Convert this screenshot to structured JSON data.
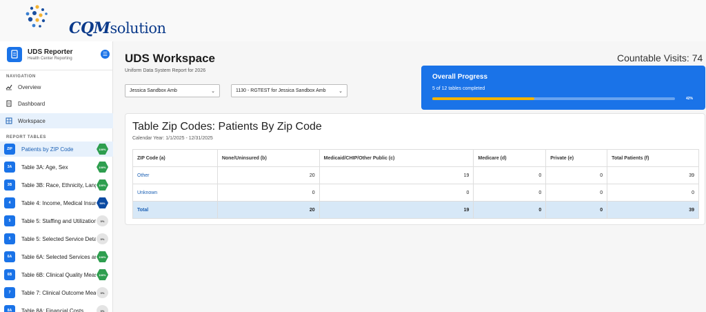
{
  "logo": {
    "text_prefix": "CQM",
    "text_suffix": "solution"
  },
  "sidebar": {
    "brand_title": "UDS Reporter",
    "brand_subtitle": "Health Center Reporting",
    "navigation_label": "NAVIGATION",
    "nav": [
      {
        "label": "Overview",
        "icon": "chart-line-icon"
      },
      {
        "label": "Dashboard",
        "icon": "document-icon"
      },
      {
        "label": "Workspace",
        "icon": "table-grid-icon"
      }
    ],
    "report_tables_label": "REPORT TABLES",
    "tables": [
      {
        "code": "ZIP",
        "label": "Patients by ZIP Code",
        "badge": "100%",
        "status": "complete"
      },
      {
        "code": "3A",
        "label": "Table 3A: Age, Sex",
        "badge": "100%",
        "status": "complete"
      },
      {
        "code": "3B",
        "label": "Table 3B: Race, Ethnicity, Lang",
        "badge": "100%",
        "status": "complete"
      },
      {
        "code": "4",
        "label": "Table 4: Income, Medical Insura",
        "badge": "90%",
        "status": "partial"
      },
      {
        "code": "5",
        "label": "Table 5: Staffing and Utilization",
        "badge": "0%",
        "status": "none"
      },
      {
        "code": "5",
        "label": "Table 5: Selected Service Detai",
        "badge": "0%",
        "status": "none"
      },
      {
        "code": "6A",
        "label": "Table 6A: Selected Services an",
        "badge": "100%",
        "status": "complete"
      },
      {
        "code": "6B",
        "label": "Table 6B: Clinical Quality Meas",
        "badge": "100%",
        "status": "complete"
      },
      {
        "code": "7",
        "label": "Table 7: Clinical Outcome Meas",
        "badge": "0%",
        "status": "none"
      },
      {
        "code": "8A",
        "label": "Table 8A: Financial Costs",
        "badge": "0%",
        "status": "none"
      }
    ]
  },
  "main": {
    "title": "UDS Workspace",
    "subtitle": "Uniform Data System Report for 2026",
    "countable_visits": "Countable Visits: 74",
    "select_org": "Jessica Sandbox Amb",
    "select_site": "1130 - RGTEST for Jessica Sandbox Amb"
  },
  "progress": {
    "title": "Overall Progress",
    "subtitle": "5 of 12 tables completed",
    "percent_label": "42%",
    "fraction": 0.42
  },
  "table_card": {
    "title": "Table Zip Codes: Patients By Zip Code",
    "subtitle": "Calendar Year: 1/1/2025 - 12/31/2025",
    "columns": [
      "ZIP Code (a)",
      "None/Uninsured (b)",
      "Medicaid/CHIP/Other Public (c)",
      "Medicare (d)",
      "Private (e)",
      "Total Patients (f)"
    ],
    "rows": [
      [
        "Other",
        "20",
        "19",
        "0",
        "0",
        "39"
      ],
      [
        "Unknown",
        "0",
        "0",
        "0",
        "0",
        "0"
      ]
    ],
    "total": [
      "Total",
      "20",
      "19",
      "0",
      "0",
      "39"
    ]
  },
  "colors": {
    "accent": "#1a73e8",
    "progress_fill": "#f4b400",
    "badge_complete": "#2e9e4f",
    "badge_partial": "#0b4aa2",
    "badge_none": "#e4e4e4"
  }
}
